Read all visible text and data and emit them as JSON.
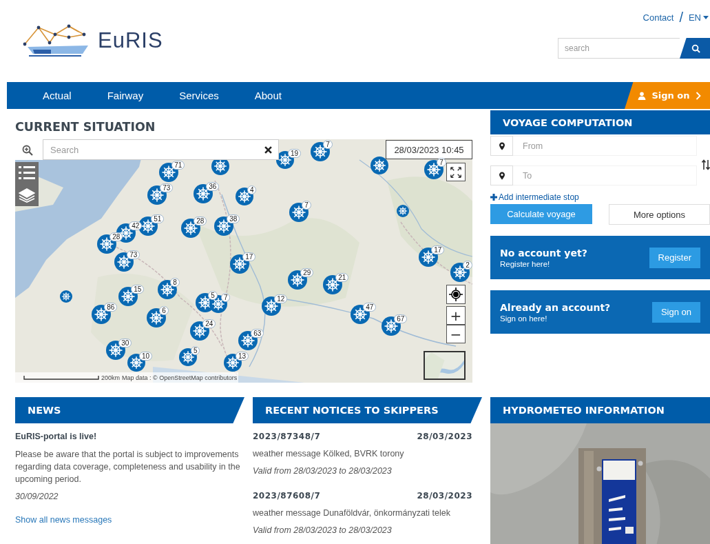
{
  "header": {
    "logo_text": "EuRIS",
    "contact": "Contact",
    "separator": "/",
    "language": "EN",
    "search": {
      "placeholder": "search"
    }
  },
  "nav": {
    "items": [
      {
        "label": "Actual"
      },
      {
        "label": "Fairway"
      },
      {
        "label": "Services"
      },
      {
        "label": "About"
      }
    ],
    "sign_on": "Sign on"
  },
  "current_situation": {
    "title": "CURRENT SITUATION",
    "map": {
      "search_placeholder": "Search",
      "datetime": "28/03/2023 10:45",
      "zoom_in": "+",
      "zoom_out": "−",
      "scale": "200km",
      "attribution": "Map data : © OpenStreetMap contributors",
      "markers": [
        {
          "kind": "cluster",
          "count": "71"
        },
        {
          "kind": "pin"
        },
        {
          "kind": "cluster",
          "count": "73"
        },
        {
          "kind": "cluster",
          "count": "36"
        },
        {
          "kind": "cluster",
          "count": "4"
        },
        {
          "kind": "cluster",
          "count": "42"
        },
        {
          "kind": "cluster",
          "count": "28"
        },
        {
          "kind": "cluster",
          "count": "51"
        },
        {
          "kind": "cluster",
          "count": "28"
        },
        {
          "kind": "cluster",
          "count": "38"
        },
        {
          "kind": "cluster",
          "count": "73"
        },
        {
          "kind": "cluster",
          "count": "17"
        },
        {
          "kind": "dot"
        },
        {
          "kind": "cluster",
          "count": "15"
        },
        {
          "kind": "cluster",
          "count": "8"
        },
        {
          "kind": "cluster",
          "count": "5"
        },
        {
          "kind": "cluster",
          "count": "7"
        },
        {
          "kind": "cluster",
          "count": "86"
        },
        {
          "kind": "cluster",
          "count": "6"
        },
        {
          "kind": "cluster",
          "count": "24"
        },
        {
          "kind": "cluster",
          "count": "30"
        },
        {
          "kind": "cluster",
          "count": "10"
        },
        {
          "kind": "cluster",
          "count": "5"
        },
        {
          "kind": "cluster",
          "count": "13"
        },
        {
          "kind": "cluster",
          "count": "19"
        },
        {
          "kind": "cluster",
          "count": "7"
        },
        {
          "kind": "pin"
        },
        {
          "kind": "cluster",
          "count": "7"
        },
        {
          "kind": "cluster",
          "count": "7"
        },
        {
          "kind": "dot"
        },
        {
          "kind": "cluster",
          "count": "12"
        },
        {
          "kind": "cluster",
          "count": "29"
        },
        {
          "kind": "cluster",
          "count": "21"
        },
        {
          "kind": "cluster",
          "count": "47"
        },
        {
          "kind": "cluster",
          "count": "67"
        },
        {
          "kind": "cluster",
          "count": "63"
        },
        {
          "kind": "cluster",
          "count": "17"
        },
        {
          "kind": "cluster",
          "count": "2"
        }
      ]
    }
  },
  "voyage": {
    "title": "VOYAGE COMPUTATION",
    "from_placeholder": "From",
    "to_placeholder": "To",
    "add_stop": "Add intermediate stop",
    "calculate": "Calculate voyage",
    "more_options": "More options"
  },
  "account_boxes": [
    {
      "title": "No account yet?",
      "subtitle": "Register here!",
      "button": "Register"
    },
    {
      "title": "Already an account?",
      "subtitle": "Sign on here!",
      "button": "Sign on"
    }
  ],
  "news": {
    "title": "NEWS",
    "headline": "EuRIS-portal is live!",
    "body": "Please be aware that the portal is subject to improvements regarding data coverage, completeness and usability in the upcoming period.",
    "date": "30/09/2022",
    "link": "Show all news messages"
  },
  "notices": {
    "title": "RECENT NOTICES TO SKIPPERS",
    "items": [
      {
        "id": "2023/87348/7",
        "date": "28/03/2023",
        "message": "weather message Kölked, BVRK torony",
        "validity": "Valid from 28/03/2023 to 28/03/2023"
      },
      {
        "id": "2023/87608/7",
        "date": "28/03/2023",
        "message": "weather message Dunaföldvár, önkormányzati telek",
        "validity": "Valid from 28/03/2023 to 28/03/2023"
      }
    ]
  },
  "hydrometeo": {
    "title": "HYDROMETEO INFORMATION"
  }
}
